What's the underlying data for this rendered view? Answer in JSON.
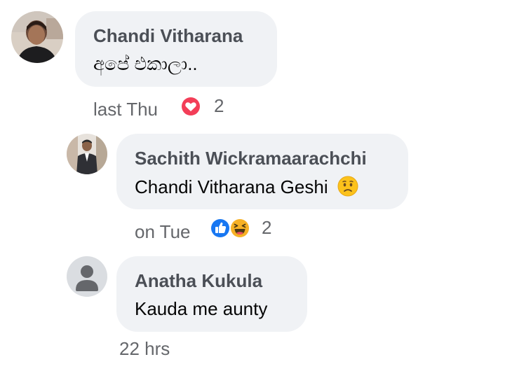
{
  "comments": [
    {
      "author": "Chandi Vitharana",
      "text": "අපේ එකාලා..",
      "time": "last Thu",
      "reaction_icons": [
        "love-icon"
      ],
      "reaction_count": "2"
    },
    {
      "author": "Sachith Wickramaarachchi",
      "text": "Chandi Vitharana Geshi",
      "emoji": "worried-face-emoji",
      "time": "on Tue",
      "reaction_icons": [
        "like-icon",
        "haha-icon"
      ],
      "reaction_count": "2"
    },
    {
      "author": "Anatha Kukula",
      "text": "Kauda me aunty",
      "time": "22 hrs"
    }
  ],
  "colors": {
    "bubble": "#f0f2f5",
    "author": "#4b4f56",
    "meta": "#65676b",
    "love": "#f33e58",
    "like": "#1877f2",
    "haha": "#f7b125"
  }
}
